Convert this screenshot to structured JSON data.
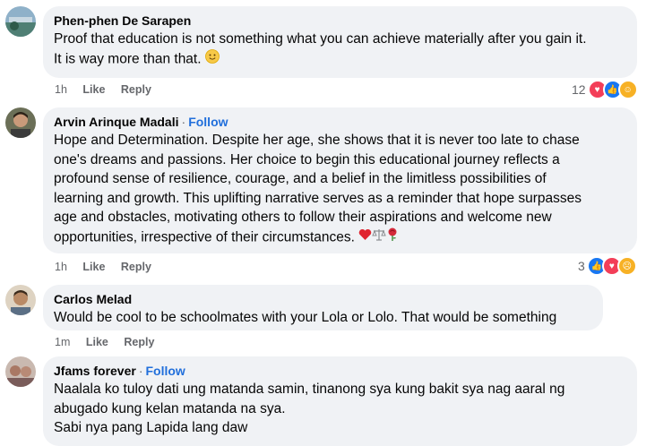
{
  "comments": [
    {
      "author": "Phen-phen De Sarapen",
      "follow": "",
      "text": "Proof that education is not something what you can achieve materially after you gain it.\nIt is way more than that.",
      "emojis": [
        "slightly-smiling-face"
      ],
      "time": "1h",
      "like": "Like",
      "reply": "Reply",
      "reaction_count": "12",
      "reactions": [
        "love",
        "like",
        "care"
      ]
    },
    {
      "author": "Arvin Arinque Madali",
      "sep": "·",
      "follow": "Follow",
      "text": "Hope and Determination. Despite her age, she shows that it is never too late to chase\none's dreams and passions. Her choice to begin this educational journey reflects a\nprofound sense of resilience, courage, and a belief in the limitless possibilities of\nlearning and growth. This uplifting narrative serves as a reminder that hope surpasses\nage and obstacles, motivating others to follow their aspirations and welcome new\nopportunities, irrespective of their circumstances.",
      "emojis": [
        "red-heart",
        "balance-scale",
        "rose"
      ],
      "time": "1h",
      "like": "Like",
      "reply": "Reply",
      "reaction_count": "3",
      "reactions": [
        "like",
        "love",
        "sad"
      ]
    },
    {
      "author": "Carlos Melad",
      "follow": "",
      "text": "Would be cool to be schoolmates with your Lola or Lolo. That would be something",
      "emojis": [],
      "time": "1m",
      "like": "Like",
      "reply": "Reply",
      "reaction_count": "",
      "reactions": []
    },
    {
      "author": "Jfams forever",
      "sep": "·",
      "follow": "Follow",
      "text": "Naalala ko tuloy dati ung matanda samin, tinanong sya kung bakit sya nag aaral ng\nabugado kung kelan matanda na sya.\nSabi nya pang Lapida lang daw",
      "emojis": [],
      "time": "",
      "like": "",
      "reply": "",
      "reaction_count": "",
      "reactions": []
    }
  ],
  "colors": {
    "bubble": "#f0f2f5",
    "follow": "#216fdb",
    "meta": "#65676b",
    "like": "#1877f2",
    "love": "#f33e58",
    "care": "#f7b125"
  }
}
